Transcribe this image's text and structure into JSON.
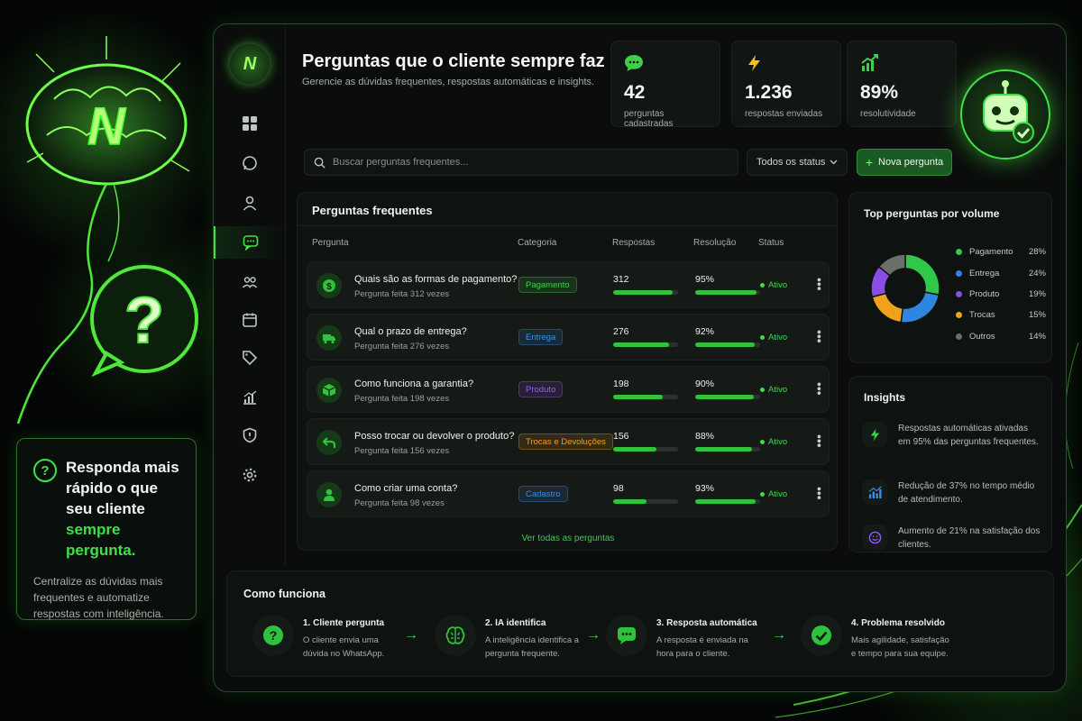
{
  "promo": {
    "title_part1": "Responda mais rápido o que seu cliente ",
    "title_highlight": "sempre pergunta.",
    "description": "Centralize as dúvidas mais frequentes e automatize respostas com inteligência."
  },
  "sidebar": {
    "logo_letter": "N",
    "items": [
      {
        "icon": "dashboard-icon"
      },
      {
        "icon": "whatsapp-icon"
      },
      {
        "icon": "user-icon"
      },
      {
        "icon": "chat-icon",
        "active": true
      },
      {
        "icon": "users-icon"
      },
      {
        "icon": "calendar-icon"
      },
      {
        "icon": "tag-icon"
      },
      {
        "icon": "chart-icon"
      },
      {
        "icon": "shield-icon"
      },
      {
        "icon": "gear-icon"
      }
    ]
  },
  "header": {
    "title": "Perguntas que o cliente sempre faz",
    "subtitle": "Gerencie as dúvidas frequentes, respostas automáticas e insights."
  },
  "stats": [
    {
      "value": "42",
      "label": "perguntas cadastradas",
      "icon": "chat-bubble-icon"
    },
    {
      "value": "1.236",
      "label": "respostas enviadas",
      "icon": "lightning-icon"
    },
    {
      "value": "89%",
      "label": "resolutividade",
      "icon": "growth-chart-icon"
    }
  ],
  "toolbar": {
    "search_placeholder": "Buscar perguntas frequentes...",
    "status_filter": "Todos os status",
    "new_button": "Nova pergunta"
  },
  "faq": {
    "title": "Perguntas frequentes",
    "columns": [
      "Pergunta",
      "Categoria",
      "Respostas",
      "Resolução",
      "Status"
    ],
    "rows": [
      {
        "question": "Quais são as formas de pagamento?",
        "sub": "Pergunta feita 312 vezes",
        "category": "Pagamento",
        "responses": "312",
        "responses_fill": 0.92,
        "resolution": "95%",
        "resolution_fill": 0.95,
        "status": "Ativo",
        "icon": "dollar-icon"
      },
      {
        "question": "Qual o prazo de entrega?",
        "sub": "Pergunta feita 276 vezes",
        "category": "Entrega",
        "responses": "276",
        "responses_fill": 0.86,
        "resolution": "92%",
        "resolution_fill": 0.92,
        "status": "Ativo",
        "icon": "truck-icon"
      },
      {
        "question": "Como funciona a garantia?",
        "sub": "Pergunta feita 198 vezes",
        "category": "Produto",
        "responses": "198",
        "responses_fill": 0.77,
        "resolution": "90%",
        "resolution_fill": 0.9,
        "status": "Ativo",
        "icon": "box-icon"
      },
      {
        "question": "Posso trocar ou devolver o produto?",
        "sub": "Pergunta feita 156 vezes",
        "category": "Trocas e Devoluções",
        "responses": "156",
        "responses_fill": 0.66,
        "resolution": "88%",
        "resolution_fill": 0.88,
        "status": "Ativo",
        "icon": "return-arrow-icon"
      },
      {
        "question": "Como criar uma conta?",
        "sub": "Pergunta feita 98 vezes",
        "category": "Cadastro",
        "responses": "98",
        "responses_fill": 0.52,
        "resolution": "93%",
        "resolution_fill": 0.93,
        "status": "Ativo",
        "icon": "person-icon"
      }
    ],
    "see_all": "Ver todas as perguntas"
  },
  "category_colors": {
    "Pagamento": "#3fd04b",
    "Entrega": "#3a8fe6",
    "Produto": "#9b5cf0",
    "Trocas e Devoluções": "#f0a020",
    "Cadastro": "#3a8fe6"
  },
  "top_questions": {
    "title": "Top perguntas por volume",
    "slices": [
      {
        "name": "Pagamento",
        "pct": "28%",
        "value": 28,
        "color": "#2fc84a"
      },
      {
        "name": "Entrega",
        "pct": "24%",
        "value": 24,
        "color": "#2f86e0"
      },
      {
        "name": "Produto",
        "pct": "19%",
        "value": 19,
        "color": "#f0a21c"
      },
      {
        "name": "Trocas",
        "pct": "15%",
        "value": 15,
        "color": "#8a4ee6"
      },
      {
        "name": "Outros",
        "pct": "14%",
        "value": 14,
        "color": "#6b6f6c"
      }
    ]
  },
  "insights": {
    "title": "Insights",
    "items": [
      {
        "text": "Respostas automáticas ativadas em 95% das perguntas frequentes.",
        "icon": "lightning-icon"
      },
      {
        "text": "Redução de 37% no tempo médio de atendimento.",
        "icon": "bar-chart-icon"
      },
      {
        "text": "Aumento de 21% na satisfação dos clientes.",
        "icon": "smile-icon"
      }
    ]
  },
  "how": {
    "title": "Como funciona",
    "steps": [
      {
        "title": "1. Cliente pergunta",
        "desc": "O cliente envia uma dúvida no WhatsApp.",
        "icon": "question-icon"
      },
      {
        "title": "2. IA identifica",
        "desc": "A inteligência identifica a pergunta frequente.",
        "icon": "brain-icon"
      },
      {
        "title": "3. Resposta automática",
        "desc": "A resposta é enviada na hora para o cliente.",
        "icon": "message-icon"
      },
      {
        "title": "4. Problema resolvido",
        "desc": "Mais agilidade, satisfação e tempo para sua equipe.",
        "icon": "check-icon"
      }
    ]
  }
}
